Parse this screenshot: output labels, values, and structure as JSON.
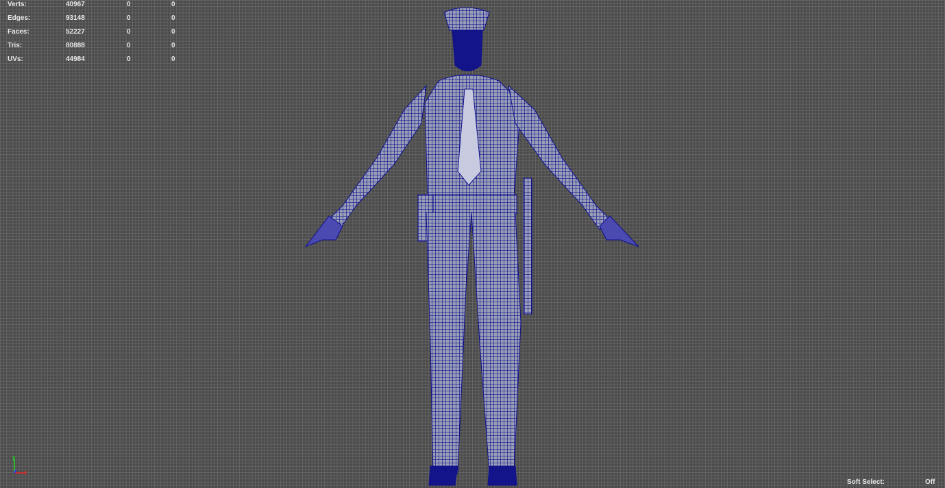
{
  "stats": [
    {
      "label": "Verts:",
      "values": [
        "40967",
        "0",
        "0"
      ]
    },
    {
      "label": "Edges:",
      "values": [
        "93148",
        "0",
        "0"
      ]
    },
    {
      "label": "Faces:",
      "values": [
        "52227",
        "0",
        "0"
      ]
    },
    {
      "label": "Tris:",
      "values": [
        "80888",
        "0",
        "0"
      ]
    },
    {
      "label": "UVs:",
      "values": [
        "44984",
        "0",
        "0"
      ]
    }
  ],
  "soft_select": {
    "label": "Soft Select:",
    "value": "Off"
  },
  "axis": {
    "x": "x",
    "y": "y"
  },
  "colors": {
    "wire": "#10108a",
    "mesh": "#8a8fa8",
    "background": "#4b4b4b"
  }
}
